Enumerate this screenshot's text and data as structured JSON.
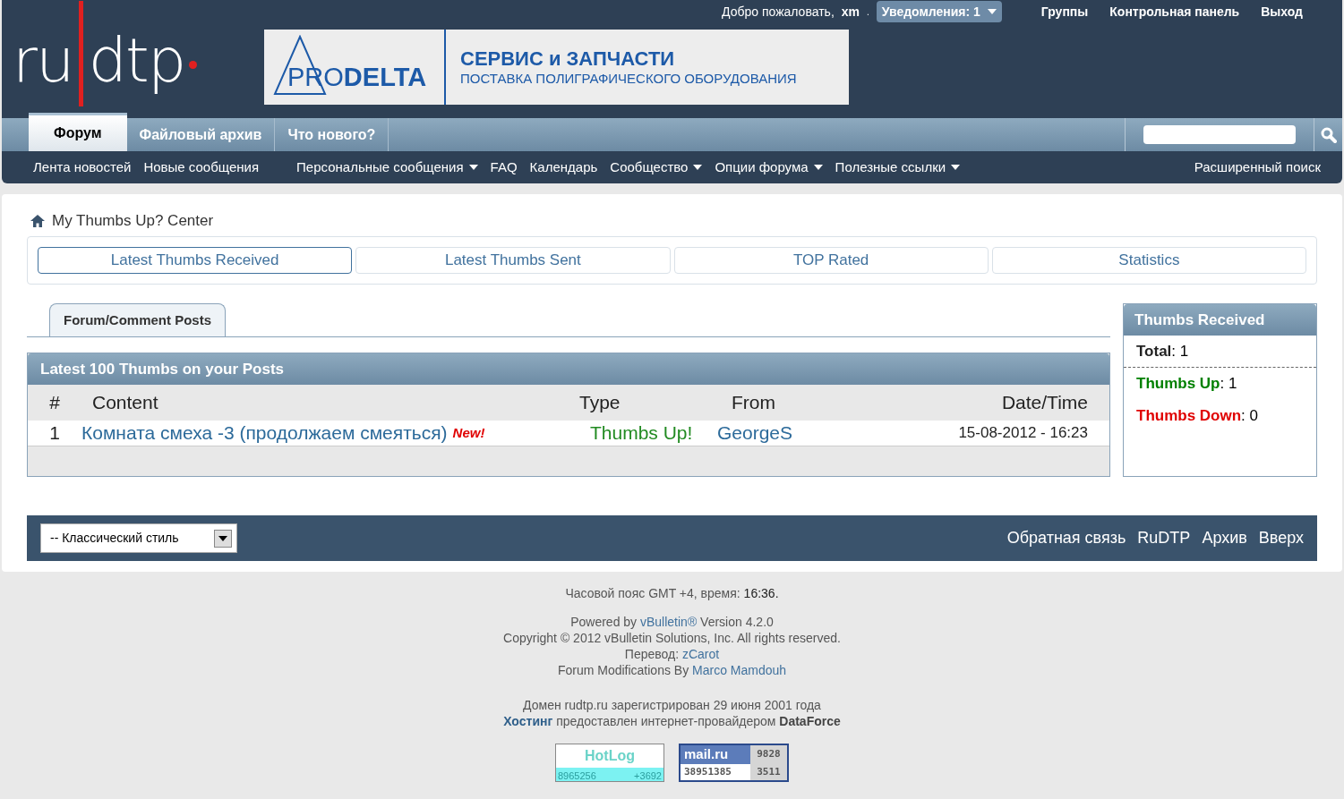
{
  "header": {
    "logo": {
      "left": "ru",
      "right": "dtp"
    },
    "welcome": "Добро пожаловать,",
    "user": "xm",
    "separator": ".",
    "notifications": {
      "label": "Уведомления: 1",
      "dropdown": true
    },
    "links": [
      "Группы",
      "Контрольная панель",
      "Выход"
    ],
    "banner": {
      "brand_light": "PRO",
      "brand_bold": "DELTA",
      "title": "СЕРВИС и ЗАПЧАСТИ",
      "subtitle": "ПОСТАВКА ПОЛИГРАФИЧЕСКОГО ОБОРУДОВАНИЯ"
    }
  },
  "nav_tabs": [
    {
      "label": "Форум",
      "selected": true
    },
    {
      "label": "Файловый архив",
      "selected": false
    },
    {
      "label": "Что нового?",
      "selected": false
    }
  ],
  "subnav": {
    "items": [
      {
        "label": "Лента новостей",
        "dropdown": false
      },
      {
        "label": "Новые сообщения",
        "dropdown": false
      },
      {
        "label": "Персональные сообщения",
        "dropdown": true
      },
      {
        "label": "FAQ",
        "dropdown": false
      },
      {
        "label": "Календарь",
        "dropdown": false
      },
      {
        "label": "Сообщество",
        "dropdown": true
      },
      {
        "label": "Опции форума",
        "dropdown": true
      },
      {
        "label": "Полезные ссылки",
        "dropdown": true
      }
    ],
    "advanced_search": "Расширенный поиск"
  },
  "breadcrumb": "My Thumbs Up? Center",
  "thumb_tabs": [
    {
      "label": "Latest Thumbs Received",
      "selected": true
    },
    {
      "label": "Latest Thumbs Sent",
      "selected": false
    },
    {
      "label": "TOP Rated",
      "selected": false
    },
    {
      "label": "Statistics",
      "selected": false
    }
  ],
  "content_tabs": [
    {
      "label": "Forum/Comment Posts",
      "selected": true
    }
  ],
  "table": {
    "title": "Latest 100 Thumbs on your Posts",
    "columns": [
      "#",
      "Content",
      "Type",
      "From",
      "Date/Time"
    ],
    "rows": [
      {
        "number": "1",
        "content": "Комната смеха -3 (продолжаем смеяться)",
        "badge": "New!",
        "type": "Thumbs Up!",
        "from": "GeorgeS",
        "datetime": "15-08-2012 - 16:23"
      }
    ]
  },
  "sidebar": {
    "title": "Thumbs Received",
    "separator": ":",
    "stats": [
      {
        "label": "Total",
        "value": "1",
        "color": "#222222"
      },
      {
        "label": "Thumbs Up",
        "value": "1",
        "color": "#008000"
      },
      {
        "label": "Thumbs Down",
        "value": "0",
        "color": "#e00000"
      }
    ]
  },
  "footer_bar": {
    "style_select": "-- Классический стиль",
    "links": [
      "Обратная связь",
      "RuDTP",
      "Архив",
      "Вверх"
    ]
  },
  "footer": {
    "timezone": "Часовой пояс GMT +4, время:",
    "time": "16:36.",
    "lines": [
      {
        "parts": [
          {
            "kind": "text",
            "text": "Powered by"
          },
          {
            "kind": "link",
            "text": "vBulletin®"
          },
          {
            "kind": "text",
            "text": "Version 4.2.0"
          }
        ]
      },
      {
        "parts": [
          {
            "kind": "text",
            "text": "Copyright © 2012 vBulletin Solutions, Inc. All rights reserved."
          }
        ]
      },
      {
        "parts": [
          {
            "kind": "text",
            "text": "Перевод:"
          },
          {
            "kind": "link",
            "text": "zCarot"
          }
        ]
      },
      {
        "parts": [
          {
            "kind": "text",
            "text": "Forum Modifications By"
          },
          {
            "kind": "link",
            "text": "Marco Mamdouh"
          }
        ]
      }
    ],
    "domain": "Домен rudtp.ru зарегистрирован 29 июня 2001 года",
    "hosting": [
      {
        "kind": "boldlink",
        "text": "Хостинг"
      },
      {
        "kind": "text",
        "text": "предоставлен интернет-провайдером"
      },
      {
        "kind": "bold",
        "text": "DataForce"
      }
    ],
    "counters": [
      {
        "kind": "hotlog",
        "title": "HotLog",
        "values": [
          "8965256",
          "+3692"
        ]
      },
      {
        "kind": "mailru",
        "title": "mail.ru",
        "values": [
          "9828",
          "38951385",
          "3511"
        ]
      }
    ]
  }
}
